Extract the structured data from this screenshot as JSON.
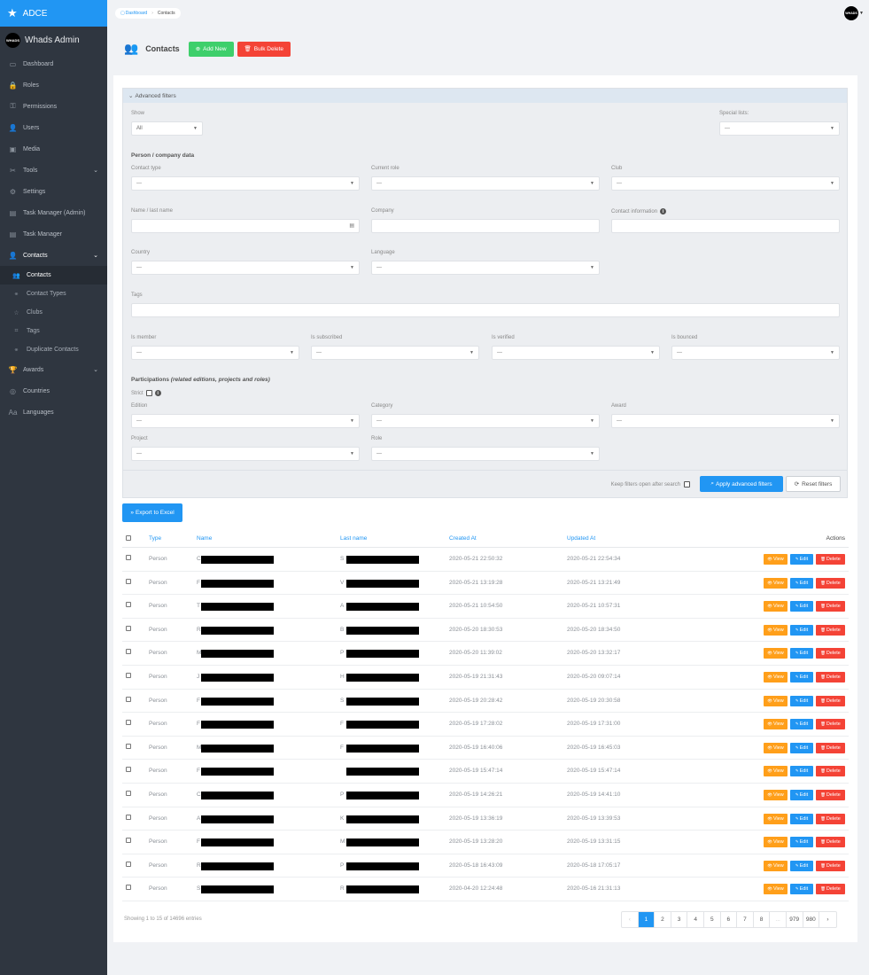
{
  "sidebar": {
    "brand": "ADCE",
    "admin_logo": "WHADS",
    "admin_name": "Whads Admin",
    "items": [
      {
        "label": "Dashboard",
        "icon": "calendar-icon"
      },
      {
        "label": "Roles",
        "icon": "lock-icon"
      },
      {
        "label": "Permissions",
        "icon": "key-icon"
      },
      {
        "label": "Users",
        "icon": "user-icon"
      },
      {
        "label": "Media",
        "icon": "image-icon"
      },
      {
        "label": "Tools",
        "icon": "tools-icon"
      },
      {
        "label": "Settings",
        "icon": "gear-icon"
      },
      {
        "label": "Task Manager (Admin)",
        "icon": "document-icon"
      },
      {
        "label": "Task Manager",
        "icon": "document-icon"
      },
      {
        "label": "Contacts",
        "icon": "user-icon"
      }
    ],
    "sub_items": [
      {
        "label": "Contacts",
        "icon": "users-icon"
      },
      {
        "label": "Contact Types",
        "icon": "group-icon"
      },
      {
        "label": "Clubs",
        "icon": "star-icon"
      },
      {
        "label": "Tags",
        "icon": "tag-icon"
      },
      {
        "label": "Duplicate Contacts",
        "icon": "group-icon"
      }
    ],
    "items_after": [
      {
        "label": "Awards",
        "icon": "trophy-icon"
      },
      {
        "label": "Countries",
        "icon": "globe-icon"
      },
      {
        "label": "Languages",
        "icon": "language-icon"
      }
    ]
  },
  "breadcrumb": {
    "home": "Dashboard",
    "current": "Contacts"
  },
  "top_avatar": "WHADS",
  "page": {
    "title": "Contacts",
    "add_new": "Add New",
    "bulk_delete": "Bulk Delete"
  },
  "filters": {
    "title": "Advanced filters",
    "show_label": "Show",
    "show_value": "All",
    "special_lists_label": "Special lists:",
    "placeholder": "---",
    "person_section": "Person / company data",
    "contact_type": "Contact type",
    "current_role": "Current role",
    "club": "Club",
    "name_last": "Name / last name",
    "company": "Company",
    "contact_info": "Contact information",
    "country": "Country",
    "language": "Language",
    "tags": "Tags",
    "is_member": "Is member",
    "is_subscribed": "Is subscribed",
    "is_verified": "Is verified",
    "is_bounced": "Is bounced",
    "participations": "Participations",
    "participations_note": "(related editions, projects and roles)",
    "strict": "Strict",
    "edition": "Edition",
    "category": "Category",
    "award": "Award",
    "project": "Project",
    "role": "Role",
    "keep_open": "Keep filters open after search",
    "apply": "Apply advanced filters",
    "reset": "Reset filters"
  },
  "export": "Export to Excel",
  "table": {
    "headers": {
      "type": "Type",
      "name": "Name",
      "last_name": "Last name",
      "created": "Created At",
      "updated": "Updated At",
      "actions": "Actions"
    },
    "actions": {
      "view": "View",
      "edit": "Edit",
      "delete": "Delete"
    },
    "rows": [
      {
        "type": "Person",
        "name_initial": "C",
        "last_initial": "S",
        "created": "2020-05-21 22:50:32",
        "updated": "2020-05-21 22:54:34"
      },
      {
        "type": "Person",
        "name_initial": "F",
        "last_initial": "V",
        "created": "2020-05-21 13:19:28",
        "updated": "2020-05-21 13:21:49"
      },
      {
        "type": "Person",
        "name_initial": "T",
        "last_initial": "A",
        "created": "2020-05-21 10:54:50",
        "updated": "2020-05-21 10:57:31"
      },
      {
        "type": "Person",
        "name_initial": "R",
        "last_initial": "B",
        "created": "2020-05-20 18:30:53",
        "updated": "2020-05-20 18:34:50"
      },
      {
        "type": "Person",
        "name_initial": "M",
        "last_initial": "P",
        "created": "2020-05-20 11:39:02",
        "updated": "2020-05-20 13:32:17"
      },
      {
        "type": "Person",
        "name_initial": "J",
        "last_initial": "H",
        "created": "2020-05-19 21:31:43",
        "updated": "2020-05-20 09:07:14"
      },
      {
        "type": "Person",
        "name_initial": "F",
        "last_initial": "S",
        "created": "2020-05-19 20:28:42",
        "updated": "2020-05-19 20:30:58"
      },
      {
        "type": "Person",
        "name_initial": "F",
        "last_initial": "F",
        "created": "2020-05-19 17:28:02",
        "updated": "2020-05-19 17:31:00"
      },
      {
        "type": "Person",
        "name_initial": "M",
        "last_initial": "F",
        "created": "2020-05-19 16:40:06",
        "updated": "2020-05-19 16:45:03"
      },
      {
        "type": "Person",
        "name_initial": "F",
        "last_initial": "",
        "created": "2020-05-19 15:47:14",
        "updated": "2020-05-19 15:47:14"
      },
      {
        "type": "Person",
        "name_initial": "C",
        "last_initial": "P",
        "created": "2020-05-19 14:26:21",
        "updated": "2020-05-19 14:41:10"
      },
      {
        "type": "Person",
        "name_initial": "A",
        "last_initial": "K",
        "created": "2020-05-19 13:36:19",
        "updated": "2020-05-19 13:39:53"
      },
      {
        "type": "Person",
        "name_initial": "F",
        "last_initial": "M",
        "created": "2020-05-19 13:28:20",
        "updated": "2020-05-19 13:31:15"
      },
      {
        "type": "Person",
        "name_initial": "R",
        "last_initial": "P",
        "created": "2020-05-18 16:43:09",
        "updated": "2020-05-18 17:05:17"
      },
      {
        "type": "Person",
        "name_initial": "S",
        "last_initial": "R",
        "created": "2020-04-20 12:24:48",
        "updated": "2020-05-16 21:31:13"
      }
    ]
  },
  "entries": "Showing 1 to 15 of 14696 entries",
  "pagination": [
    "‹",
    "1",
    "2",
    "3",
    "4",
    "5",
    "6",
    "7",
    "8",
    "...",
    "979",
    "980",
    "›"
  ]
}
